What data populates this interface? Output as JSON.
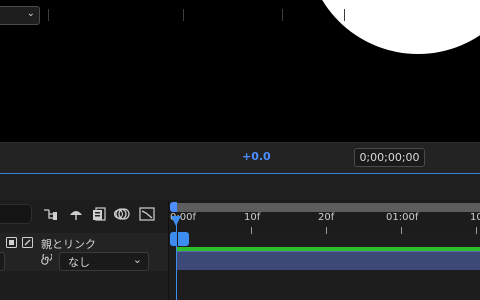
{
  "toolbar": {
    "exposure_value": "+0.0",
    "timecode": "0;00;00;00"
  },
  "timeline": {
    "ruler_labels": [
      "0:00f",
      "10f",
      "20f",
      "01:00f",
      "10"
    ],
    "column_header": "親とリンク",
    "parent_value": "なし"
  },
  "colors": {
    "accent": "#4c8dff",
    "layer_bar": "#3d4a78",
    "green_track": "#2dbd2d"
  }
}
